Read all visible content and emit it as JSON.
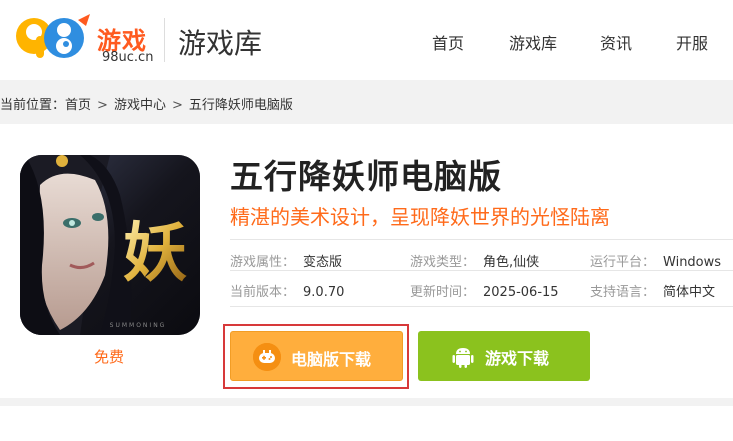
{
  "header": {
    "logo_text": "游戏",
    "logo_sub": "98uc.cn",
    "section_title": "游戏库",
    "nav": [
      "首页",
      "游戏库",
      "资讯",
      "开服"
    ]
  },
  "breadcrumb": {
    "prefix": "当前位置：",
    "items": [
      "首页",
      "游戏中心",
      "五行降妖师电脑版"
    ]
  },
  "game": {
    "icon_char": "妖",
    "icon_caption": "SUMMONING",
    "price_label": "免费",
    "title": "五行降妖师电脑版",
    "slogan": "精湛的美术设计，呈现降妖世界的光怪陆离",
    "meta": [
      {
        "key": "游戏属性：",
        "value": "变态版"
      },
      {
        "key": "游戏类型：",
        "value": "角色,仙侠"
      },
      {
        "key": "运行平台：",
        "value": "Windows"
      },
      {
        "key": "当前版本：",
        "value": "9.0.70"
      },
      {
        "key": "更新时间：",
        "value": "2025-06-15"
      },
      {
        "key": "支持语言：",
        "value": "简体中文"
      }
    ]
  },
  "buttons": {
    "pc_download": "电脑版下载",
    "game_download": "游戏下载"
  },
  "colors": {
    "accent_orange": "#ff6a1a",
    "pc_button": "#ffae3d",
    "game_button": "#8bc21e",
    "highlight_box": "#d7393a"
  },
  "icons": [
    "logo-98-icon",
    "gamepad-icon",
    "android-icon"
  ]
}
